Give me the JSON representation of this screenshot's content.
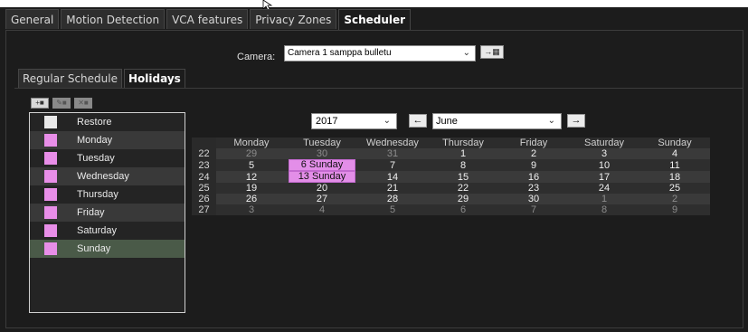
{
  "tabs": [
    {
      "label": "General",
      "active": false
    },
    {
      "label": "Motion Detection",
      "active": false
    },
    {
      "label": "VCA features",
      "active": false
    },
    {
      "label": "Privacy Zones",
      "active": false
    },
    {
      "label": "Scheduler",
      "active": true
    }
  ],
  "camera": {
    "label": "Camera:",
    "value": "Camera 1 samppa bulletu",
    "button_icon": "camera-go-icon"
  },
  "subtabs": [
    {
      "label": "Regular Schedule",
      "active": false
    },
    {
      "label": "Holidays",
      "active": true
    }
  ],
  "toolbar": {
    "icons": [
      "add-icon",
      "edit-icon",
      "delete-icon"
    ]
  },
  "days": [
    {
      "label": "Restore",
      "color": "#e8e8e8",
      "selected": false
    },
    {
      "label": "Monday",
      "color": "#e88ee8",
      "selected": false
    },
    {
      "label": "Tuesday",
      "color": "#e88ee8",
      "selected": false
    },
    {
      "label": "Wednesday",
      "color": "#e88ee8",
      "selected": false
    },
    {
      "label": "Thursday",
      "color": "#e88ee8",
      "selected": false
    },
    {
      "label": "Friday",
      "color": "#e88ee8",
      "selected": false
    },
    {
      "label": "Saturday",
      "color": "#e88ee8",
      "selected": false
    },
    {
      "label": "Sunday",
      "color": "#e88ee8",
      "selected": true
    }
  ],
  "calendar": {
    "year": "2017",
    "month": "June",
    "prev_icon": "arrow-left-icon",
    "next_icon": "arrow-right-icon",
    "headers": [
      "Monday",
      "Tuesday",
      "Wednesday",
      "Thursday",
      "Friday",
      "Saturday",
      "Sunday"
    ],
    "holiday_color": "#e38ee8",
    "weeks": [
      {
        "week": "22",
        "days": [
          {
            "t": "29",
            "m": true
          },
          {
            "t": "30",
            "m": true
          },
          {
            "t": "31",
            "m": true
          },
          {
            "t": "1"
          },
          {
            "t": "2"
          },
          {
            "t": "3"
          },
          {
            "t": "4"
          }
        ]
      },
      {
        "week": "23",
        "days": [
          {
            "t": "5"
          },
          {
            "t": "6 Sunday",
            "h": true
          },
          {
            "t": "7"
          },
          {
            "t": "8"
          },
          {
            "t": "9"
          },
          {
            "t": "10"
          },
          {
            "t": "11"
          }
        ]
      },
      {
        "week": "24",
        "days": [
          {
            "t": "12"
          },
          {
            "t": "13 Sunday",
            "h": true
          },
          {
            "t": "14"
          },
          {
            "t": "15"
          },
          {
            "t": "16"
          },
          {
            "t": "17"
          },
          {
            "t": "18"
          }
        ]
      },
      {
        "week": "25",
        "days": [
          {
            "t": "19"
          },
          {
            "t": "20"
          },
          {
            "t": "21"
          },
          {
            "t": "22"
          },
          {
            "t": "23"
          },
          {
            "t": "24"
          },
          {
            "t": "25"
          }
        ]
      },
      {
        "week": "26",
        "days": [
          {
            "t": "26"
          },
          {
            "t": "27"
          },
          {
            "t": "28"
          },
          {
            "t": "29"
          },
          {
            "t": "30"
          },
          {
            "t": "1",
            "m": true
          },
          {
            "t": "2",
            "m": true
          }
        ]
      },
      {
        "week": "27",
        "days": [
          {
            "t": "3",
            "m": true
          },
          {
            "t": "4",
            "m": true
          },
          {
            "t": "5",
            "m": true
          },
          {
            "t": "6",
            "m": true
          },
          {
            "t": "7",
            "m": true
          },
          {
            "t": "8",
            "m": true
          },
          {
            "t": "9",
            "m": true
          }
        ]
      }
    ]
  }
}
